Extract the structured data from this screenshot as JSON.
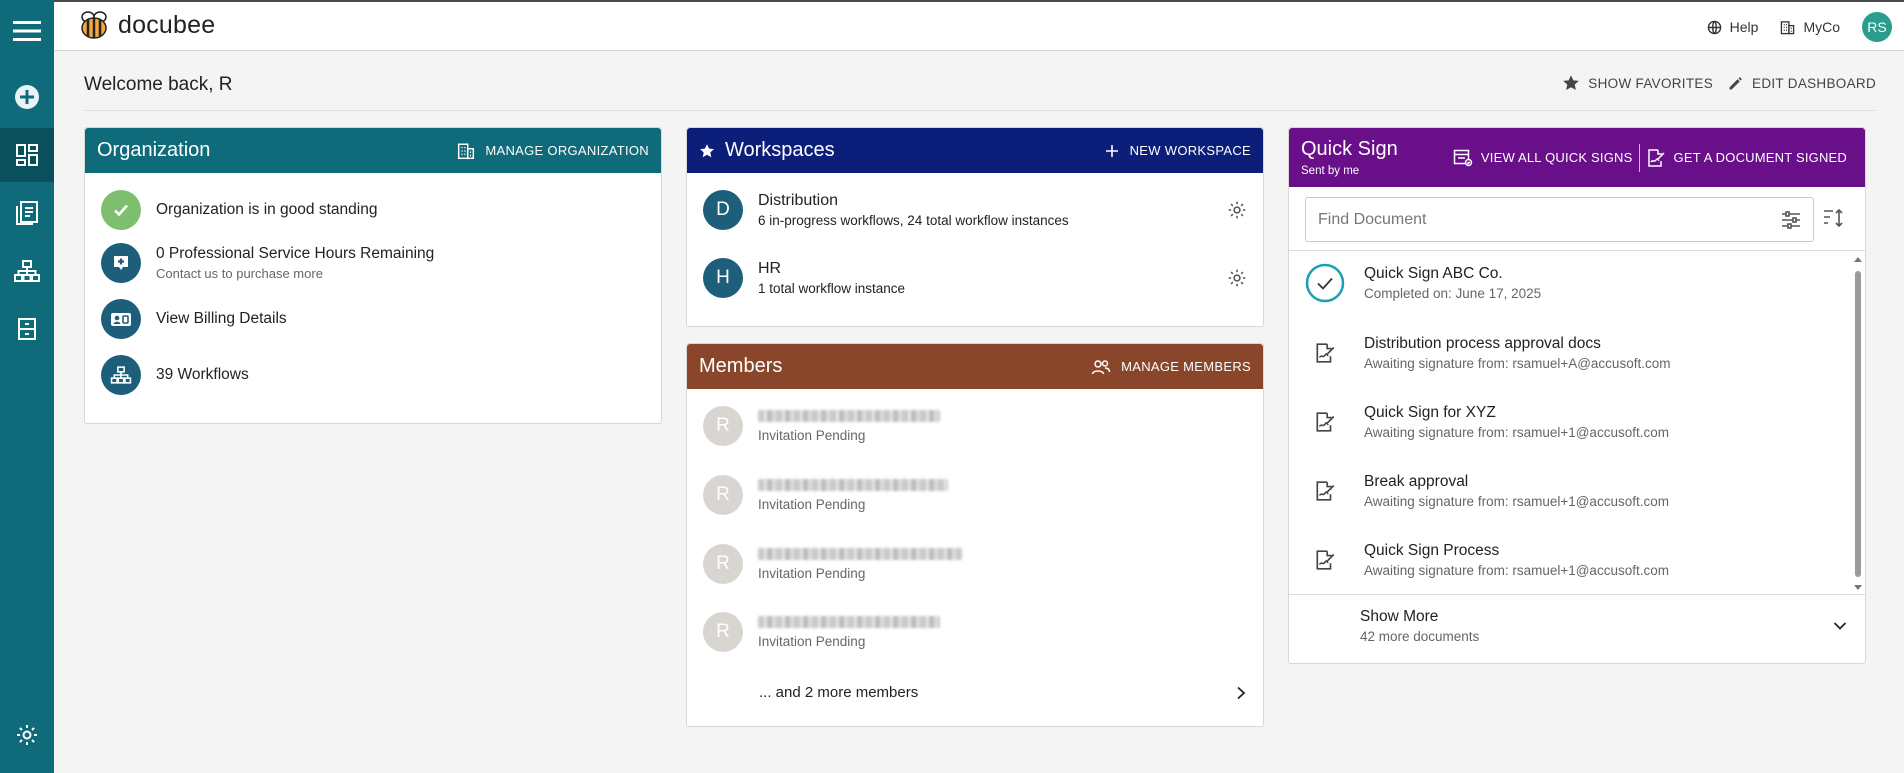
{
  "app": {
    "name": "docubee"
  },
  "topbar": {
    "help": "Help",
    "org": "MyCo",
    "avatar_initials": "RS"
  },
  "welcome": "Welcome back, R",
  "dashboard_actions": {
    "show_favorites": "SHOW FAVORITES",
    "edit_dashboard": "EDIT DASHBOARD"
  },
  "organization": {
    "title": "Organization",
    "action": "MANAGE ORGANIZATION",
    "rows": [
      {
        "text": "Organization is in good standing",
        "sub": ""
      },
      {
        "text": "0 Professional Service Hours Remaining",
        "sub": "Contact us to purchase more"
      },
      {
        "text": "View Billing Details",
        "sub": ""
      },
      {
        "text": "39 Workflows",
        "sub": ""
      }
    ]
  },
  "workspaces": {
    "title": "Workspaces",
    "action": "NEW WORKSPACE",
    "items": [
      {
        "initial": "D",
        "name": "Distribution",
        "desc": "6 in-progress workflows, 24 total workflow instances"
      },
      {
        "initial": "H",
        "name": "HR",
        "desc": "1 total workflow instance"
      }
    ]
  },
  "members": {
    "title": "Members",
    "action": "MANAGE MEMBERS",
    "items": [
      {
        "initial": "R",
        "status": "Invitation Pending"
      },
      {
        "initial": "R",
        "status": "Invitation Pending"
      },
      {
        "initial": "R",
        "status": "Invitation Pending"
      },
      {
        "initial": "R",
        "status": "Invitation Pending"
      }
    ],
    "more": "... and 2 more members"
  },
  "quick_sign": {
    "title": "Quick Sign",
    "subtitle": "Sent by me",
    "view_all": "VIEW ALL QUICK SIGNS",
    "get_signed": "GET A DOCUMENT SIGNED",
    "search_placeholder": "Find Document",
    "items": [
      {
        "name": "Quick Sign ABC Co.",
        "meta": "Completed on: June 17, 2025",
        "icon": "check-circle-icon"
      },
      {
        "name": "Distribution process approval docs",
        "meta": "Awaiting signature from: rsamuel+A@accusoft.com",
        "icon": "signature-doc-icon"
      },
      {
        "name": "Quick Sign for XYZ",
        "meta": "Awaiting signature from: rsamuel+1@accusoft.com",
        "icon": "signature-doc-icon"
      },
      {
        "name": "Break approval",
        "meta": "Awaiting signature from: rsamuel+1@accusoft.com",
        "icon": "signature-doc-icon"
      },
      {
        "name": "Quick Sign Process",
        "meta": "Awaiting signature from: rsamuel+1@accusoft.com",
        "icon": "signature-doc-icon"
      }
    ],
    "show_more": "Show More",
    "show_more_sub": "42 more documents"
  },
  "colors": {
    "rail": "#0f6b7a",
    "organization": "#0f6b7a",
    "workspaces": "#0b1f7a",
    "members": "#8a462a",
    "quick_sign": "#6a0f8a"
  }
}
